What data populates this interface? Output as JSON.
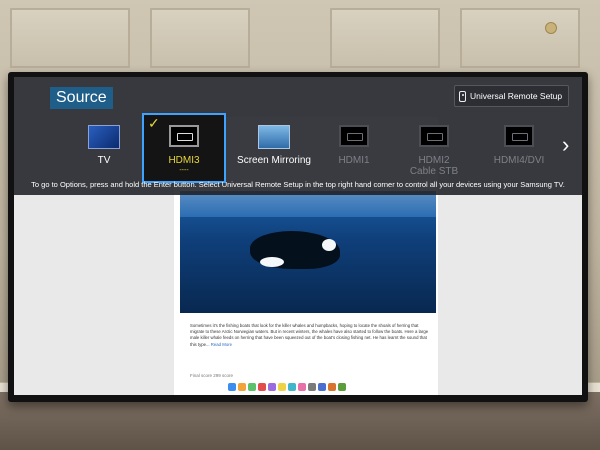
{
  "overlay": {
    "title": "Source",
    "remote_setup_label": "Universal Remote Setup",
    "sources": [
      {
        "label": "TV",
        "icon": "tv-thumbnail-icon",
        "state": "available"
      },
      {
        "label": "HDMI3",
        "sublabel": "----",
        "icon": "hdmi-icon",
        "state": "selected"
      },
      {
        "label": "Screen Mirroring",
        "icon": "screen-mirroring-icon",
        "state": "available"
      },
      {
        "label": "HDMI1",
        "icon": "hdmi-icon",
        "state": "unavailable"
      },
      {
        "label": "HDMI2\nCable STB",
        "icon": "hdmi-icon",
        "state": "unavailable"
      },
      {
        "label": "HDMI4/DVI",
        "icon": "hdmi-icon",
        "state": "unavailable"
      }
    ],
    "selected_check": "✓",
    "next_arrow": "›",
    "hint": "To go to Options, press and hold the Enter button. Select Universal Remote Setup in the top right hand corner to control all your devices using your Samsung TV."
  },
  "background_page": {
    "article_text": "Sometimes it's the fishing boats that look for the killer whales and humpbacks, hoping to locate the shoals of herring that migrate to these Arctic Norwegian waters. But in recent winters, the whales have also started to follow the boats. Here a large male killer whale feeds on herring that have been squeezed out of the boat's closing fishing net. He has learnt the sound that this type...",
    "read_more": "Read More",
    "views": "Final score 299 score"
  },
  "colors": {
    "selection_border": "#3ea2ff",
    "selected_text": "#e7d63a",
    "title_bg": "#1e5e88"
  }
}
